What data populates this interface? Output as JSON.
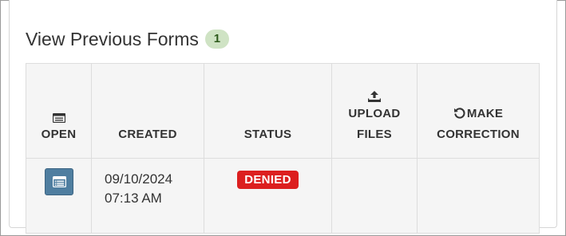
{
  "section": {
    "title": "View Previous Forms",
    "count": "1"
  },
  "table": {
    "headers": {
      "open": "OPEN",
      "created": "CREATED",
      "status": "STATUS",
      "upload_line1": "UPLOAD",
      "upload_line2": "FILES",
      "correction_line1": "MAKE",
      "correction_line2": "CORRECTION"
    },
    "rows": [
      {
        "created_date": "09/10/2024",
        "created_time": "07:13 AM",
        "status": "DENIED",
        "upload_files": "",
        "make_correction": ""
      }
    ]
  },
  "colors": {
    "denied": "#dc1f1f",
    "open_button": "#4f7ea0",
    "count_badge": "#cfe3c4"
  },
  "icons": {
    "open_header": "form-list-icon",
    "upload_header": "upload-icon",
    "correction_header": "undo-icon",
    "open_button": "form-list-icon"
  }
}
